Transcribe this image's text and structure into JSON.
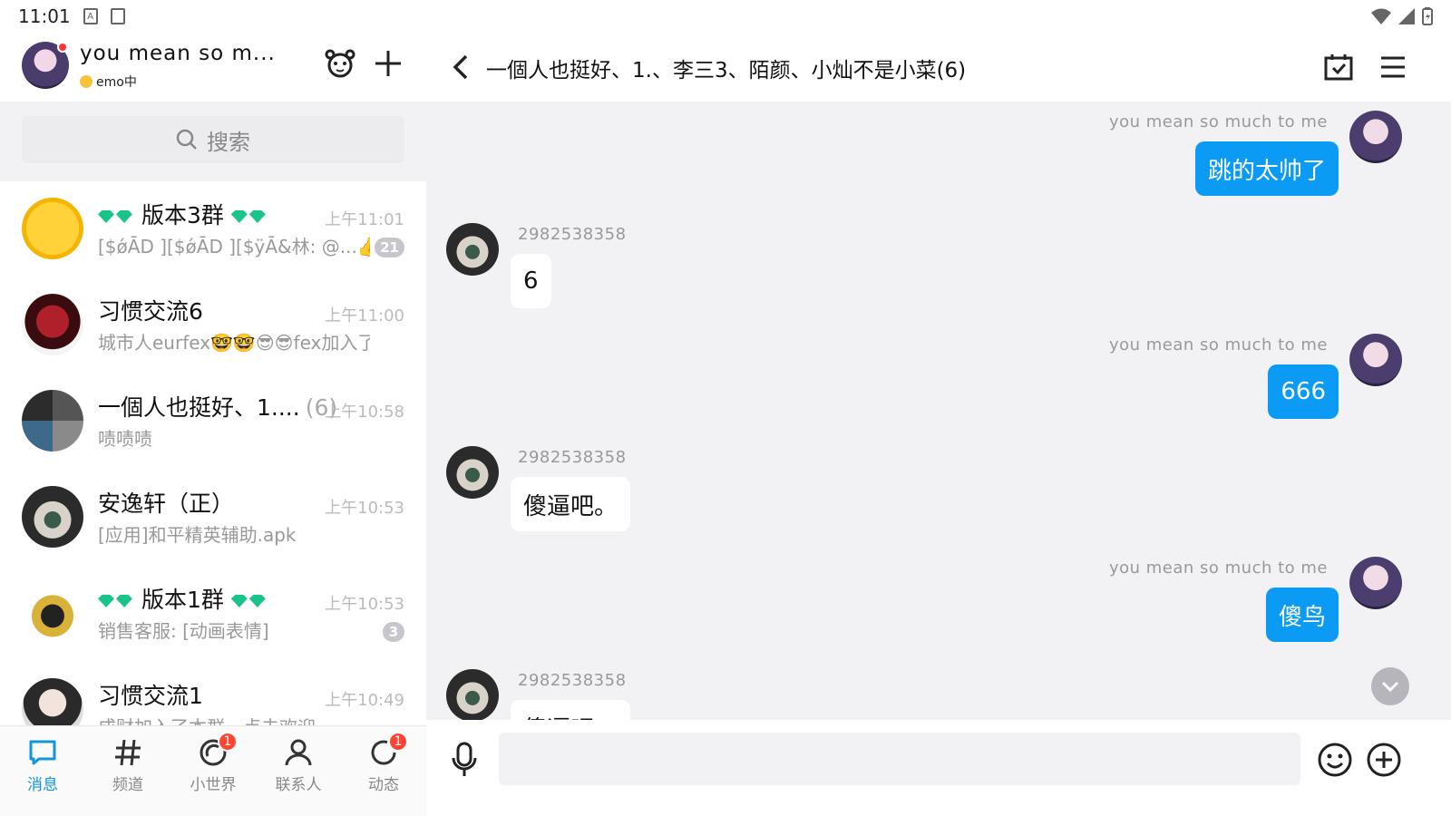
{
  "status_bar": {
    "time": "11:01"
  },
  "profile": {
    "name": "you  mean  so  m...",
    "status": "emo中"
  },
  "search": {
    "placeholder": "搜索"
  },
  "conversations": [
    {
      "title_prefix": "",
      "title": "版本3群",
      "time": "上午11:01",
      "message": "[$ǿĀD ][$ǿĀD ][$ÿĀ&林: @...👍",
      "badge": "21"
    },
    {
      "title": "习惯交流6",
      "time": "上午11:00",
      "message": "城市人eurfex🤓🤓😎😎fex加入了...",
      "badge": ""
    },
    {
      "title": "一個人也挺好、1....",
      "count": "(6)",
      "time": "上午10:58",
      "message": "啧啧啧",
      "badge": ""
    },
    {
      "title": "安逸轩（正）",
      "time": "上午10:53",
      "message": "[应用]和平精英辅助.apk",
      "badge": ""
    },
    {
      "title": "版本1群",
      "time": "上午10:53",
      "message": "销售客服: [动画表情]",
      "badge": "3"
    },
    {
      "title": "习惯交流1",
      "time": "上午10:49",
      "message": "成财加入了本群，点击欢迎",
      "badge": ""
    }
  ],
  "tabs": [
    {
      "label": "消息",
      "icon": "message-icon",
      "badge": ""
    },
    {
      "label": "频道",
      "icon": "hashtag-icon",
      "badge": ""
    },
    {
      "label": "小世界",
      "icon": "world-icon",
      "badge": "1"
    },
    {
      "label": "联系人",
      "icon": "contacts-icon",
      "badge": ""
    },
    {
      "label": "动态",
      "icon": "feed-icon",
      "badge": "1"
    }
  ],
  "chat": {
    "title": "一個人也挺好、1.、李三3、陌颜、小灿不是小菜(6)",
    "messages": [
      {
        "from": "me",
        "sender": "you  mean  so  much  to  me",
        "text": "跳的太帅了"
      },
      {
        "from": "other",
        "sender": "2982538358",
        "text": "6"
      },
      {
        "from": "me",
        "sender": "you  mean  so  much  to  me",
        "text": "666"
      },
      {
        "from": "other",
        "sender": "2982538358",
        "text": "傻逼吧。"
      },
      {
        "from": "me",
        "sender": "you  mean  so  much  to  me",
        "text": "傻鸟"
      },
      {
        "from": "other",
        "sender": "2982538358",
        "text": "傻逼吧。"
      }
    ]
  },
  "colors": {
    "accent": "#1296db",
    "bubble_me": "#0b9bf5",
    "badge_red": "#f43"
  }
}
